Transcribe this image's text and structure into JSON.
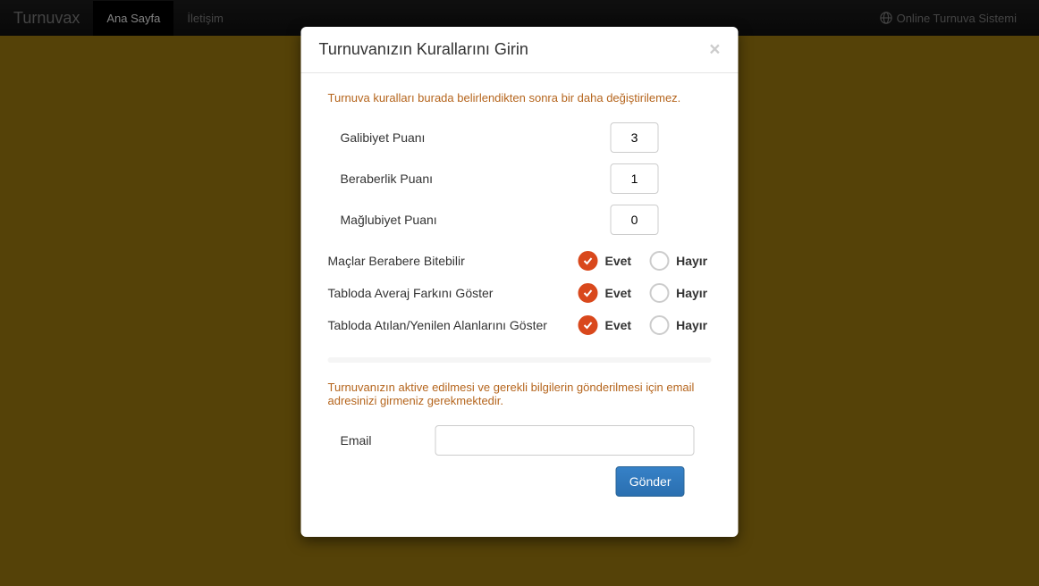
{
  "navbar": {
    "brand": "Turnuvax",
    "home": "Ana Sayfa",
    "contact": "İletişim",
    "right": "Online Turnuva Sistemi"
  },
  "modal": {
    "title": "Turnuvanızın Kurallarını Girin",
    "warning1": "Turnuva kuralları burada belirlendikten sonra bir daha değiştirilemez.",
    "win_label": "Galibiyet Puanı",
    "win_value": "3",
    "draw_label": "Beraberlik Puanı",
    "draw_value": "1",
    "loss_label": "Mağlubiyet Puanı",
    "loss_value": "0",
    "can_draw_label": "Maçlar Berabere Bitebilir",
    "goal_diff_label": "Tabloda Averaj Farkını Göster",
    "goals_for_against_label": "Tabloda Atılan/Yenilen Alanlarını Göster",
    "yes": "Evet",
    "no": "Hayır",
    "warning2": "Turnuvanızın aktive edilmesi ve gerekli bilgilerin gönderilmesi için email adresinizi girmeniz gerekmektedir.",
    "email_label": "Email",
    "email_value": "",
    "submit": "Gönder"
  }
}
